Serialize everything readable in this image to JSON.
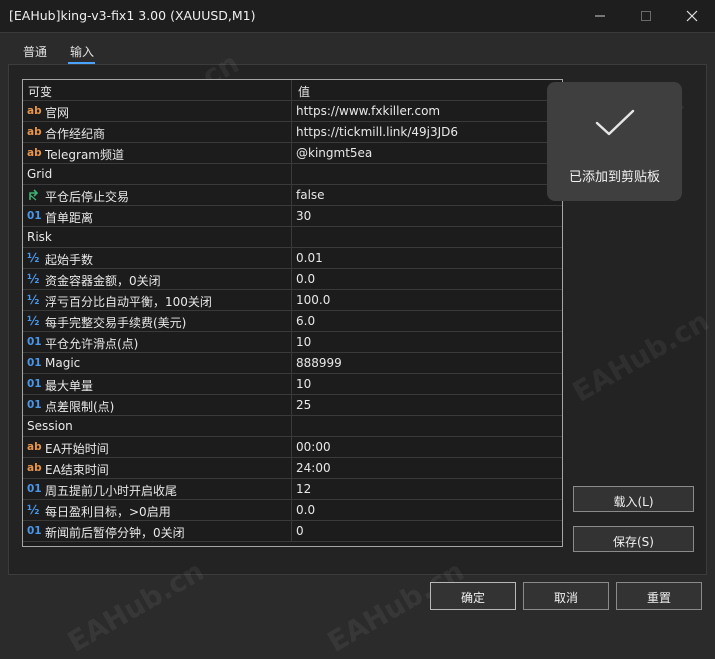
{
  "window": {
    "title": "[EAHub]king-v3-fix1 3.00 (XAUUSD,M1)"
  },
  "tabs": [
    {
      "label": "普通"
    },
    {
      "label": "输入"
    }
  ],
  "table": {
    "col_variable": "可变",
    "col_value": "值",
    "rows": [
      {
        "type": "string",
        "icon": "ab",
        "name": "官网",
        "value": "https://www.fxkiller.com"
      },
      {
        "type": "string",
        "icon": "ab",
        "name": "合作经纪商",
        "value": "https://tickmill.link/49j3JD6"
      },
      {
        "type": "string",
        "icon": "ab",
        "name": "Telegram频道",
        "value": "@kingmt5ea"
      },
      {
        "type": "group",
        "name": "Grid",
        "value": ""
      },
      {
        "type": "bool",
        "icon": "",
        "name": "平仓后停止交易",
        "value": "false"
      },
      {
        "type": "int",
        "icon": "01",
        "name": "首单距离",
        "value": "30"
      },
      {
        "type": "group",
        "name": "Risk",
        "value": ""
      },
      {
        "type": "double",
        "icon": "½",
        "name": "起始手数",
        "value": "0.01"
      },
      {
        "type": "double",
        "icon": "½",
        "name": "资金容器金额，0关闭",
        "value": "0.0"
      },
      {
        "type": "double",
        "icon": "½",
        "name": "浮亏百分比自动平衡，100关闭",
        "value": "100.0"
      },
      {
        "type": "double",
        "icon": "½",
        "name": "每手完整交易手续费(美元)",
        "value": "6.0"
      },
      {
        "type": "int",
        "icon": "01",
        "name": "平仓允许滑点(点)",
        "value": "10"
      },
      {
        "type": "int",
        "icon": "01",
        "name": "Magic",
        "value": "888999"
      },
      {
        "type": "int",
        "icon": "01",
        "name": "最大单量",
        "value": "10"
      },
      {
        "type": "int",
        "icon": "01",
        "name": "点差限制(点)",
        "value": "25"
      },
      {
        "type": "group",
        "name": "Session",
        "value": ""
      },
      {
        "type": "string",
        "icon": "ab",
        "name": "EA开始时间",
        "value": "00:00"
      },
      {
        "type": "string",
        "icon": "ab",
        "name": "EA结束时间",
        "value": "24:00"
      },
      {
        "type": "int",
        "icon": "01",
        "name": "周五提前几小时开启收尾",
        "value": "12"
      },
      {
        "type": "double",
        "icon": "½",
        "name": "每日盈利目标，>0启用",
        "value": "0.0"
      },
      {
        "type": "int",
        "icon": "01",
        "name": "新闻前后暂停分钟，0关闭",
        "value": "0"
      }
    ]
  },
  "toast": {
    "message": "已添加到剪贴板"
  },
  "buttons": {
    "load": "载入(L)",
    "save": "保存(S)",
    "ok": "确定",
    "cancel": "取消",
    "reset": "重置"
  },
  "watermark": "EAHub.cn"
}
